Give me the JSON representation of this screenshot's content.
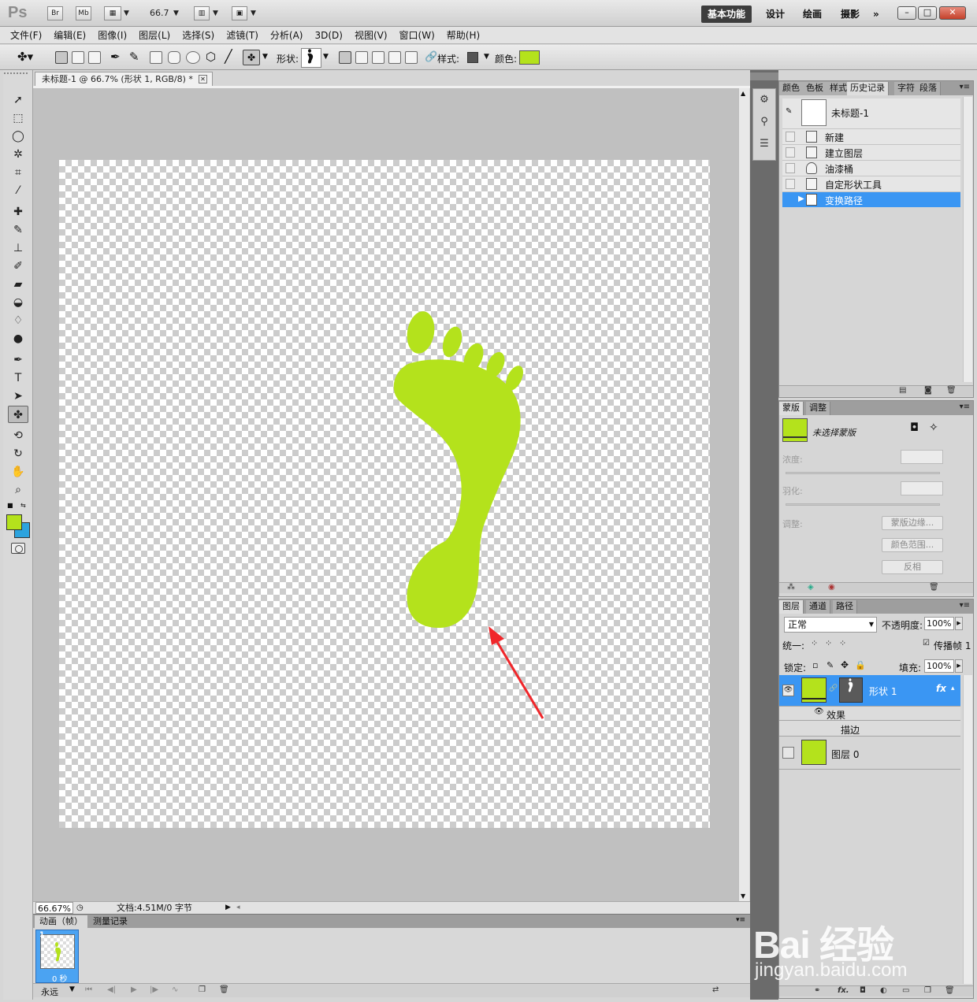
{
  "app": {
    "logo": "Ps",
    "zoom_menu": "66.7",
    "bridge_label": "Br",
    "minibridge_label": "Mb",
    "workspaces": [
      "基本功能",
      "设计",
      "绘画",
      "摄影"
    ],
    "more": "»"
  },
  "menu": [
    "文件(F)",
    "编辑(E)",
    "图像(I)",
    "图层(L)",
    "选择(S)",
    "滤镜(T)",
    "分析(A)",
    "3D(D)",
    "视图(V)",
    "窗口(W)",
    "帮助(H)"
  ],
  "options": {
    "shape_label": "形状:",
    "style_label": "样式:",
    "color_label": "颜色:",
    "color": "#b4e21c"
  },
  "document": {
    "tab_title": "未标题-1 @ 66.7% (形状 1, RGB/8) *",
    "status_zoom": "66.67%",
    "status_doc": "文档:4.51M/0 字节",
    "shape_color": "#b4e21c"
  },
  "animation": {
    "tabs": [
      "动画（帧）",
      "测量记录"
    ],
    "frame_number": "1",
    "frame_delay": "0 秒",
    "loop": "永远"
  },
  "history_panel": {
    "tabs": [
      "颜色",
      "色板",
      "样式",
      "历史记录",
      "字符",
      "段落"
    ],
    "snapshot": "未标题-1",
    "steps": [
      "新建",
      "建立图层",
      "油漆桶",
      "自定形状工具",
      "变换路径"
    ],
    "selected_step": "变换路径"
  },
  "masks_panel": {
    "tabs": [
      "蒙版",
      "调整"
    ],
    "status": "未选择蒙版",
    "density_label": "浓度:",
    "feather_label": "羽化:",
    "refine_label": "调整:",
    "buttons": [
      "蒙版边缘...",
      "颜色范围...",
      "反相"
    ]
  },
  "layers_panel": {
    "tabs": [
      "图层",
      "通道",
      "路径"
    ],
    "blend_mode": "正常",
    "opacity_label": "不透明度:",
    "opacity": "100%",
    "unify_label": "统一:",
    "propagate_label": "传播帧 1",
    "lock_label": "锁定:",
    "fill_label": "填充:",
    "fill": "100%",
    "layers": [
      {
        "name": "形状 1",
        "selected": true
      },
      {
        "name": "图层 0",
        "selected": false
      }
    ],
    "effects_label": "效果",
    "stroke_label": "描边",
    "fx": "fx"
  },
  "watermark": {
    "brand": "Bai 经验",
    "url": "jingyan.baidu.com"
  }
}
